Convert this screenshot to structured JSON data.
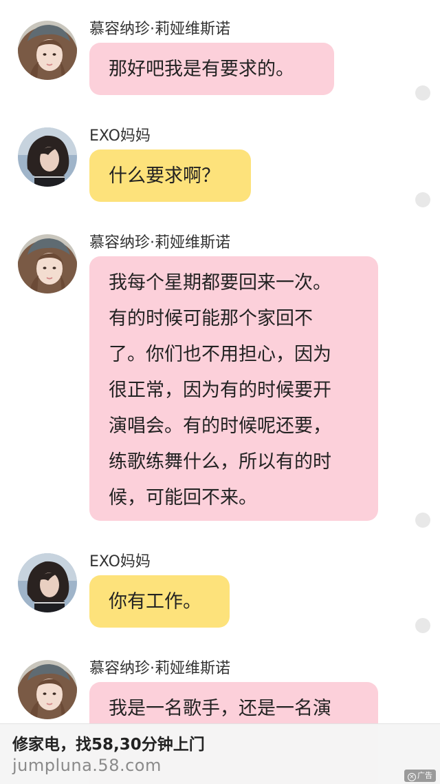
{
  "colors": {
    "bubble_pink": "#fcd0da",
    "bubble_yellow": "#fde27b",
    "status_dot": "#e8e8e8"
  },
  "messages": [
    {
      "sender": "慕容纳珍·莉娅维斯诺",
      "avatar": "girl-avatar",
      "bubble_color": "pink",
      "lines": [
        "那好吧我是有要求的。"
      ]
    },
    {
      "sender": "EXO妈妈",
      "avatar": "woman-avatar",
      "bubble_color": "yellow",
      "lines": [
        "什么要求啊？"
      ]
    },
    {
      "sender": "慕容纳珍·莉娅维斯诺",
      "avatar": "girl-avatar",
      "bubble_color": "pink",
      "lines": [
        "我每个星期都要回来一次。",
        "有的时候可能那个家回不",
        "了。你们也不用担心，因为",
        "很正常，因为有的时候要开",
        "演唱会。有的时候呢还要，",
        "练歌练舞什么，所以有的时",
        "候，可能回不来。"
      ]
    },
    {
      "sender": "EXO妈妈",
      "avatar": "woman-avatar",
      "bubble_color": "yellow",
      "lines": [
        "你有工作。"
      ]
    },
    {
      "sender": "慕容纳珍·莉娅维斯诺",
      "avatar": "girl-avatar",
      "bubble_color": "pink",
      "lines": [
        "我是一名歌手，还是一名演"
      ]
    }
  ],
  "ad": {
    "title": "修家电，找58,30分钟上门",
    "url": "jumpluna.58.com",
    "badge": "广告",
    "close_icon": "close-icon"
  }
}
